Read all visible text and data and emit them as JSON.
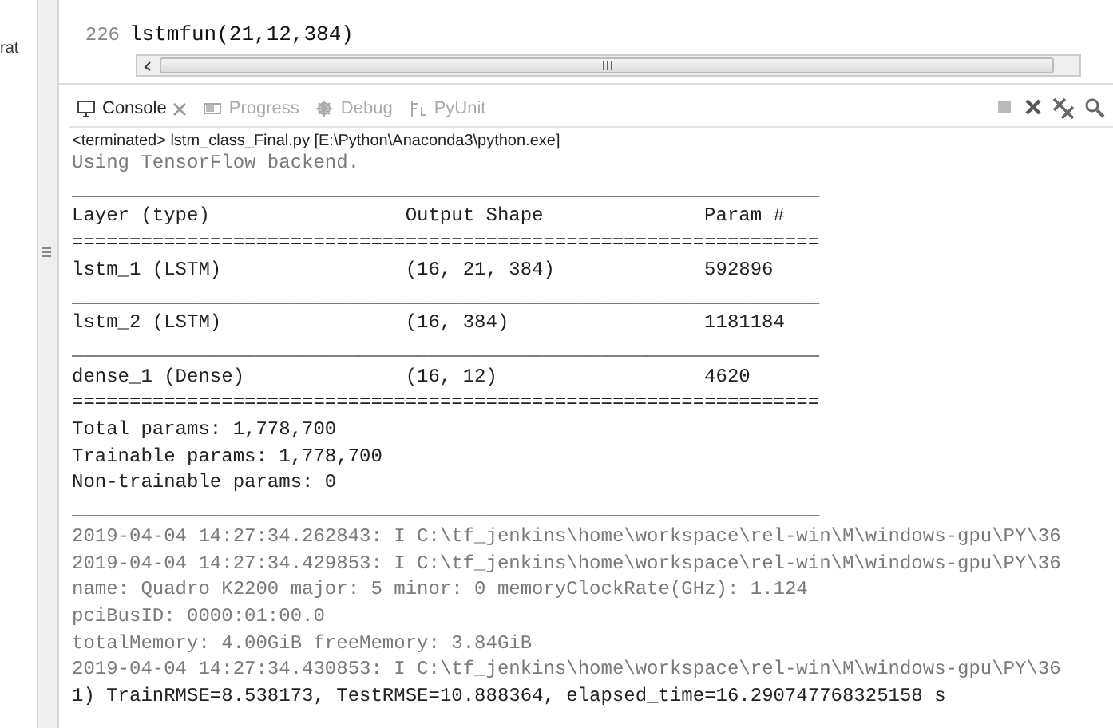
{
  "left_panel": {
    "label": "rat"
  },
  "editor": {
    "lines": [
      {
        "number": "226",
        "code": "lstmfun(21,12,384)"
      }
    ]
  },
  "console": {
    "tabs": [
      {
        "label": "Console",
        "selected": true
      },
      {
        "label": "Progress",
        "selected": false
      },
      {
        "label": "Debug",
        "selected": false
      },
      {
        "label": "PyUnit",
        "selected": false
      }
    ],
    "status": "<terminated> lstm_class_Final.py [E:\\Python\\Anaconda3\\python.exe]",
    "lines": [
      {
        "kind": "err",
        "text": "Using TensorFlow backend."
      },
      {
        "kind": "out",
        "text": "_________________________________________________________________"
      },
      {
        "kind": "row",
        "cells": [
          "Layer (type)",
          "Output Shape",
          "Param #"
        ]
      },
      {
        "kind": "out",
        "text": "================================================================="
      },
      {
        "kind": "row",
        "cells": [
          "lstm_1 (LSTM)",
          "(16, 21, 384)",
          "592896"
        ]
      },
      {
        "kind": "out",
        "text": "_________________________________________________________________"
      },
      {
        "kind": "row",
        "cells": [
          "lstm_2 (LSTM)",
          "(16, 384)",
          "1181184"
        ]
      },
      {
        "kind": "out",
        "text": "_________________________________________________________________"
      },
      {
        "kind": "row",
        "cells": [
          "dense_1 (Dense)",
          "(16, 12)",
          "4620"
        ]
      },
      {
        "kind": "out",
        "text": "================================================================="
      },
      {
        "kind": "out",
        "text": "Total params: 1,778,700"
      },
      {
        "kind": "out",
        "text": "Trainable params: 1,778,700"
      },
      {
        "kind": "out",
        "text": "Non-trainable params: 0"
      },
      {
        "kind": "out",
        "text": "_________________________________________________________________"
      },
      {
        "kind": "err",
        "text": "2019-04-04 14:27:34.262843: I C:\\tf_jenkins\\home\\workspace\\rel-win\\M\\windows-gpu\\PY\\36"
      },
      {
        "kind": "err",
        "text": "2019-04-04 14:27:34.429853: I C:\\tf_jenkins\\home\\workspace\\rel-win\\M\\windows-gpu\\PY\\36"
      },
      {
        "kind": "err",
        "text": "name: Quadro K2200 major: 5 minor: 0 memoryClockRate(GHz): 1.124"
      },
      {
        "kind": "err",
        "text": "pciBusID: 0000:01:00.0"
      },
      {
        "kind": "err",
        "text": "totalMemory: 4.00GiB freeMemory: 3.84GiB"
      },
      {
        "kind": "err",
        "text": "2019-04-04 14:27:34.430853: I C:\\tf_jenkins\\home\\workspace\\rel-win\\M\\windows-gpu\\PY\\36"
      },
      {
        "kind": "out",
        "text": "1) TrainRMSE=8.538173, TestRMSE=10.888364, elapsed_time=16.290747768325158 s"
      }
    ]
  }
}
